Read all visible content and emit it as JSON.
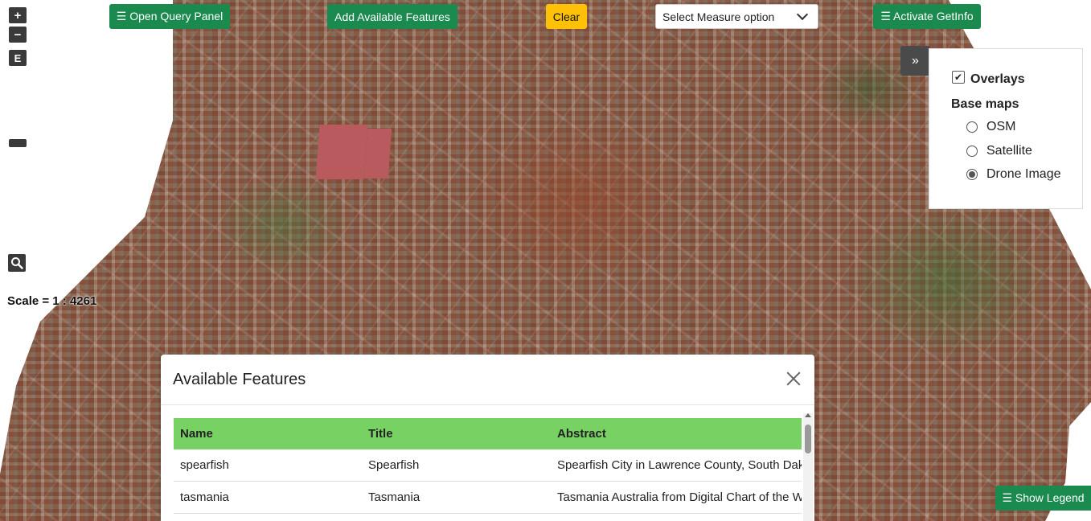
{
  "toolbar": {
    "query_panel_label": "☰ Open Query Panel",
    "add_features_label": "Add Available Features",
    "clear_label": "Clear",
    "measure_select_value": "Select Measure option",
    "getinfo_label": "☰ Activate GetInfo"
  },
  "map_controls": {
    "zoom_in": "+",
    "zoom_out": "−",
    "extent": "E",
    "scale_text": "Scale = 1 : 4261",
    "collapse_icon": "»"
  },
  "layers": {
    "overlays_label": "Overlays",
    "overlays_checked": true,
    "basemaps_label": "Base maps",
    "options": [
      {
        "label": "OSM",
        "selected": false
      },
      {
        "label": "Satellite",
        "selected": false
      },
      {
        "label": "Drone Image",
        "selected": true
      }
    ]
  },
  "features_modal": {
    "title": "Available Features",
    "columns": [
      "Name",
      "Title",
      "Abstract"
    ],
    "rows": [
      [
        "spearfish",
        "Spearfish",
        "Spearfish City in Lawrence County, South Dakota"
      ],
      [
        "tasmania",
        "Tasmania",
        "Tasmania Australia from Digital Chart of the World"
      ]
    ]
  },
  "legend_button_label": "☰ Show Legend",
  "colors": {
    "primary_green": "#1a8a4e",
    "clear_yellow": "#ffc107",
    "table_header_green": "#77d163",
    "control_dark": "#3a3a3a"
  }
}
